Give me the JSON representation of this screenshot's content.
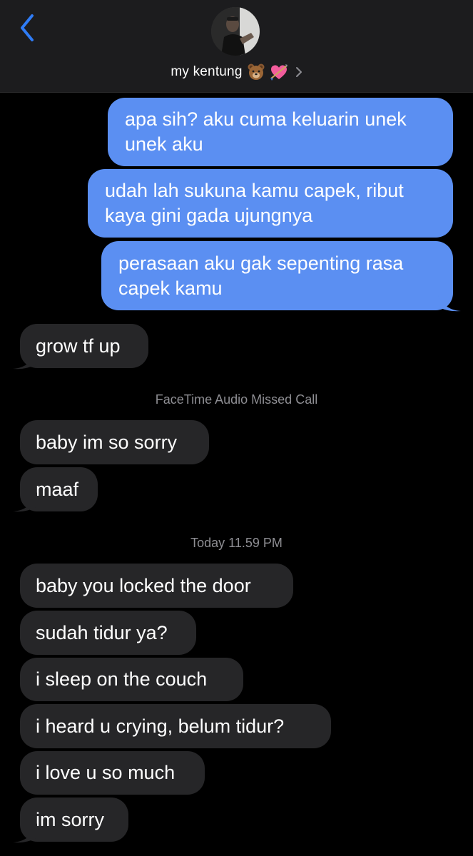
{
  "header": {
    "contact_name": "my kentung",
    "emoji_icons": [
      "bear-face-icon",
      "heart-with-arrow-icon"
    ],
    "accent_color": "#2f7cf6"
  },
  "thread": {
    "sent": [
      {
        "lines": [
          "apa sih? aku cuma keluarin unek",
          "unek aku"
        ]
      },
      {
        "lines": [
          "udah lah sukuna kamu capek, ribut",
          "kaya gini gada ujungnya"
        ]
      },
      {
        "lines": [
          "perasaan aku gak sepenting rasa",
          "capek kamu"
        ]
      }
    ],
    "received_1": "grow tf up",
    "system_missed_call": "FaceTime Audio Missed Call",
    "received_2": [
      "baby im so sorry",
      "maaf"
    ],
    "timestamp": "Today 11.59 PM",
    "received_3": [
      "baby you locked the door",
      "sudah tidur ya?",
      "i sleep on the couch",
      "i heard u crying, belum tidur?",
      "i love u so much",
      "im sorry"
    ]
  },
  "colors": {
    "sent_bubble": "#5b8ff2",
    "received_bubble": "#262628",
    "background": "#000000",
    "meta_text": "#8e8e93"
  }
}
